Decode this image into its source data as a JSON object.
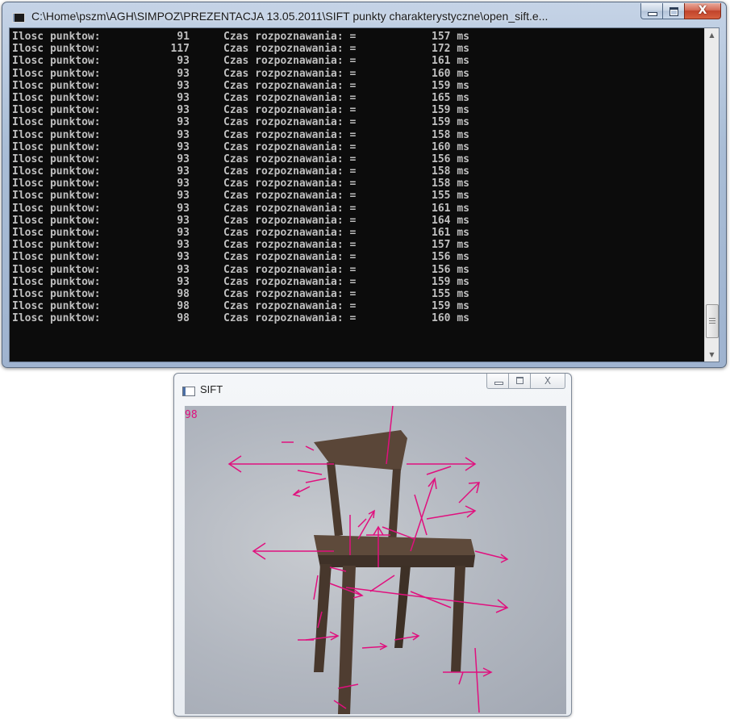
{
  "console": {
    "title": "C:\\Home\\pszm\\AGH\\SIMPOZ\\PREZENTACJA 13.05.2011\\SIFT punkty charakterystyczne\\open_sift.e...",
    "caption": {
      "close_glyph": "X"
    },
    "label_points": "Ilosc punktow:",
    "label_time": "Czas rozpoznawania: =",
    "unit": "ms",
    "lines": [
      {
        "points": "91",
        "time": "157"
      },
      {
        "points": "117",
        "time": "172"
      },
      {
        "points": "93",
        "time": "161"
      },
      {
        "points": "93",
        "time": "160"
      },
      {
        "points": "93",
        "time": "159"
      },
      {
        "points": "93",
        "time": "165"
      },
      {
        "points": "93",
        "time": "159"
      },
      {
        "points": "93",
        "time": "159"
      },
      {
        "points": "93",
        "time": "158"
      },
      {
        "points": "93",
        "time": "160"
      },
      {
        "points": "93",
        "time": "156"
      },
      {
        "points": "93",
        "time": "158"
      },
      {
        "points": "93",
        "time": "158"
      },
      {
        "points": "93",
        "time": "155"
      },
      {
        "points": "93",
        "time": "161"
      },
      {
        "points": "93",
        "time": "164"
      },
      {
        "points": "93",
        "time": "161"
      },
      {
        "points": "93",
        "time": "157"
      },
      {
        "points": "93",
        "time": "156"
      },
      {
        "points": "93",
        "time": "156"
      },
      {
        "points": "93",
        "time": "159"
      },
      {
        "points": "98",
        "time": "155"
      },
      {
        "points": "98",
        "time": "159"
      },
      {
        "points": "98",
        "time": "160"
      }
    ],
    "text_color": "#c0c0c0",
    "background_color": "#0c0c0c"
  },
  "sift": {
    "title": "SIFT",
    "caption": {
      "close_glyph": "X"
    },
    "point_count": "98",
    "overlay_color": "#e0107e"
  },
  "icons": {
    "console_app": "console-app-icon",
    "sift_app": "app-window-icon",
    "minimize": "minimize-icon",
    "maximize": "maximize-icon",
    "close": "close-icon",
    "scroll_up": "chevron-up-icon",
    "scroll_down": "chevron-down-icon"
  }
}
